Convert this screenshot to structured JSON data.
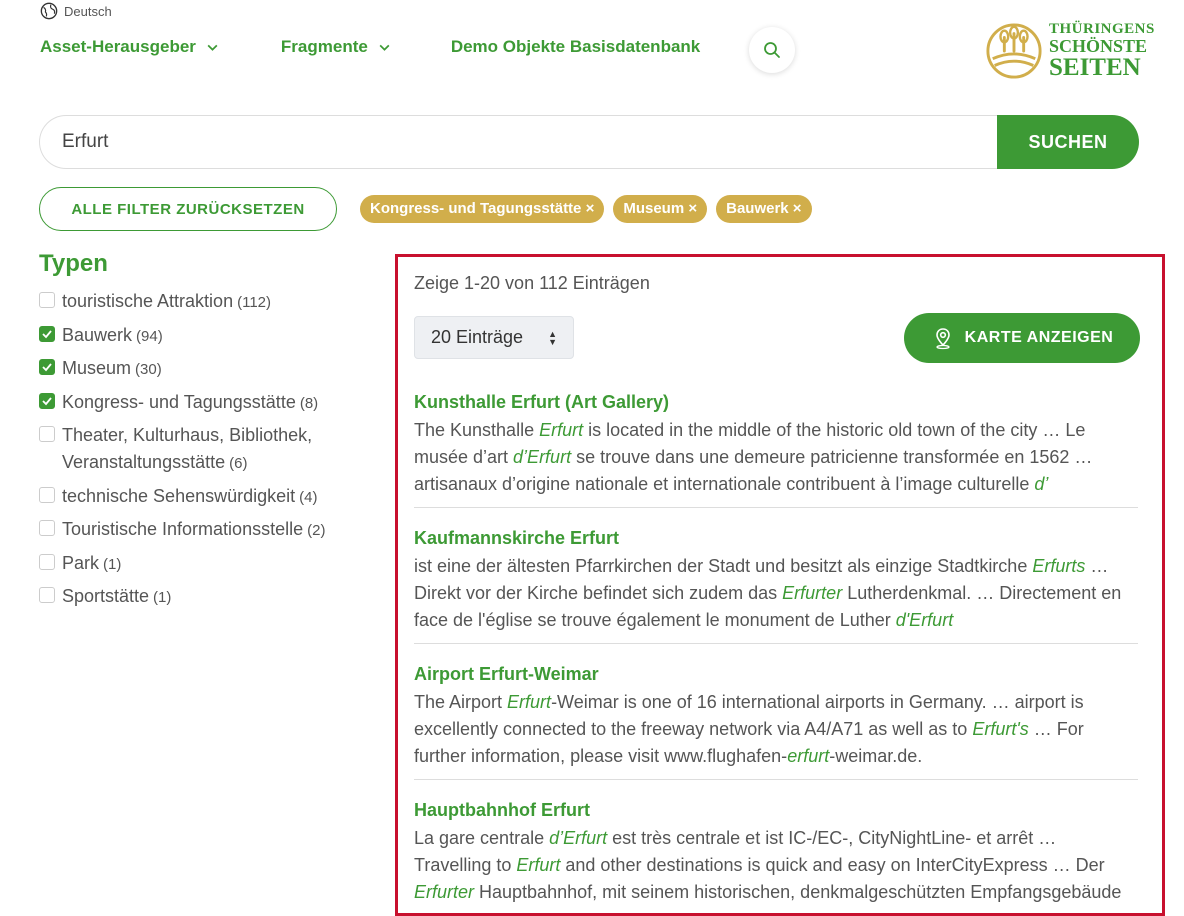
{
  "header": {
    "language": "Deutsch",
    "nav": [
      {
        "label": "Asset-Herausgeber",
        "has_dropdown": true
      },
      {
        "label": "Fragmente",
        "has_dropdown": true
      },
      {
        "label": "Demo Objekte Basisdatenbank",
        "has_dropdown": false
      }
    ],
    "logo": {
      "line1": "THÜRINGENS",
      "line2": "SCHÖNSTE",
      "line3": "SEITEN"
    }
  },
  "search": {
    "value": "Erfurt",
    "button_label": "SUCHEN"
  },
  "filters": {
    "reset_label": "ALLE FILTER ZURÜCKSETZEN",
    "active": [
      "Kongress- und Tagungsstätte ×",
      "Museum ×",
      "Bauwerk ×"
    ]
  },
  "types": {
    "title": "Typen",
    "items": [
      {
        "label": "touristische Attraktion",
        "count": "(112)",
        "checked": false
      },
      {
        "label": "Bauwerk",
        "count": "(94)",
        "checked": true
      },
      {
        "label": "Museum",
        "count": "(30)",
        "checked": true
      },
      {
        "label": "Kongress- und Tagungsstätte",
        "count": "(8)",
        "checked": true
      },
      {
        "label": "Theater, Kulturhaus, Bibliothek, Veranstaltungsstätte",
        "count": "(6)",
        "checked": false
      },
      {
        "label": "technische Sehenswürdigkeit",
        "count": "(4)",
        "checked": false
      },
      {
        "label": "Touristische Informationsstelle",
        "count": "(2)",
        "checked": false
      },
      {
        "label": "Park",
        "count": "(1)",
        "checked": false
      },
      {
        "label": "Sportstätte",
        "count": "(1)",
        "checked": false
      }
    ]
  },
  "results": {
    "summary": "Zeige 1-20 von 112 Einträgen",
    "page_size": "20 Einträge",
    "map_button": "KARTE ANZEIGEN",
    "items": [
      {
        "title": "Kunsthalle Erfurt (Art Gallery)",
        "snippet": [
          {
            "t": "The Kunsthalle "
          },
          {
            "t": "Erfurt",
            "h": true
          },
          {
            "t": " is located in the middle of the historic old town of the city … Le musée d’art "
          },
          {
            "t": "d’Erfurt",
            "h": true
          },
          {
            "t": " se trouve dans une demeure patricienne transformée en 1562 … artisanaux d’origine nationale et internationale contribuent à l’image culturelle "
          },
          {
            "t": "d’",
            "h": true
          }
        ]
      },
      {
        "title": "Kaufmannskirche Erfurt",
        "snippet": [
          {
            "t": "ist eine der ältesten Pfarrkirchen der Stadt und besitzt als einzige Stadtkirche "
          },
          {
            "t": "Erfurts",
            "h": true
          },
          {
            "t": " … Direkt vor der Kirche befindet sich zudem das "
          },
          {
            "t": "Erfurter",
            "h": true
          },
          {
            "t": " Lutherdenkmal. … Directement en face de l'église se trouve également le monument de Luther "
          },
          {
            "t": "d'Erfurt",
            "h": true
          }
        ]
      },
      {
        "title": "Airport Erfurt-Weimar",
        "snippet": [
          {
            "t": "The Airport "
          },
          {
            "t": "Erfurt",
            "h": true
          },
          {
            "t": "-Weimar is one of 16 international airports in Germany. … airport is excellently connected to the freeway network via A4/A71 as well as to "
          },
          {
            "t": "Erfurt's",
            "h": true
          },
          {
            "t": " … For further information, please visit www.flughafen-"
          },
          {
            "t": "erfurt",
            "h": true
          },
          {
            "t": "-weimar.de."
          }
        ]
      },
      {
        "title": "Hauptbahnhof Erfurt",
        "snippet": [
          {
            "t": "La gare centrale "
          },
          {
            "t": "d’Erfurt",
            "h": true
          },
          {
            "t": " est très centrale et ist IC-/EC-, CityNightLine- et arrêt … Travelling to "
          },
          {
            "t": "Erfurt",
            "h": true
          },
          {
            "t": " and other destinations is quick and easy on InterCityExpress … Der "
          },
          {
            "t": "Erfurter",
            "h": true
          },
          {
            "t": " Hauptbahnhof, mit seinem historischen, denkmalgeschützten Empfangsgebäude"
          }
        ]
      }
    ]
  },
  "colors": {
    "primary_green": "#3d9a35",
    "chip_gold": "#d1ae4b",
    "highlight_border": "#c8102e"
  }
}
